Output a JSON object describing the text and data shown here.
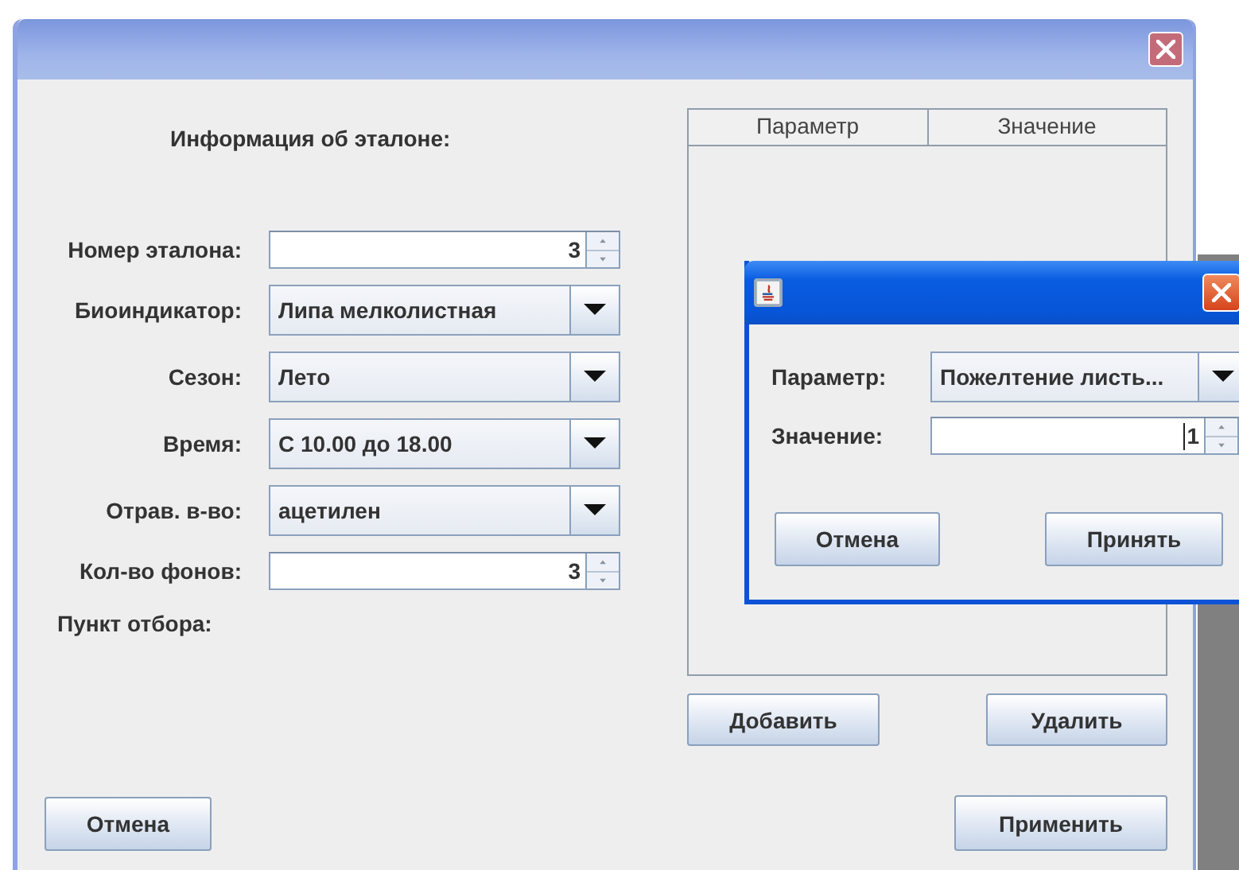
{
  "main_window": {
    "heading": "Информация об эталоне:",
    "fields": [
      {
        "label": "Номер эталона:",
        "kind": "spinner",
        "value": "3"
      },
      {
        "label": "Биоиндикатор:",
        "kind": "combo",
        "value": "Липа мелколистная"
      },
      {
        "label": "Сезон:",
        "kind": "combo",
        "value": "Лето"
      },
      {
        "label": "Время:",
        "kind": "combo",
        "value": "С 10.00 до 18.00"
      },
      {
        "label": "Отрав. в-во:",
        "kind": "combo",
        "value": "ацетилен"
      },
      {
        "label": "Кол-во фонов:",
        "kind": "spinner",
        "value": "3"
      }
    ],
    "extra_label": "Пункт отбора:",
    "table": {
      "columns": [
        "Параметр",
        "Значение"
      ]
    },
    "buttons": {
      "add": "Добавить",
      "remove": "Удалить",
      "cancel": "Отмена",
      "apply": "Применить"
    }
  },
  "dialog": {
    "fields": [
      {
        "label": "Параметр:",
        "kind": "combo",
        "value": "Пожелтение листь..."
      },
      {
        "label": "Значение:",
        "kind": "spinner",
        "value": "1",
        "focused": true
      }
    ],
    "buttons": [
      "Отмена",
      "Принять"
    ]
  }
}
